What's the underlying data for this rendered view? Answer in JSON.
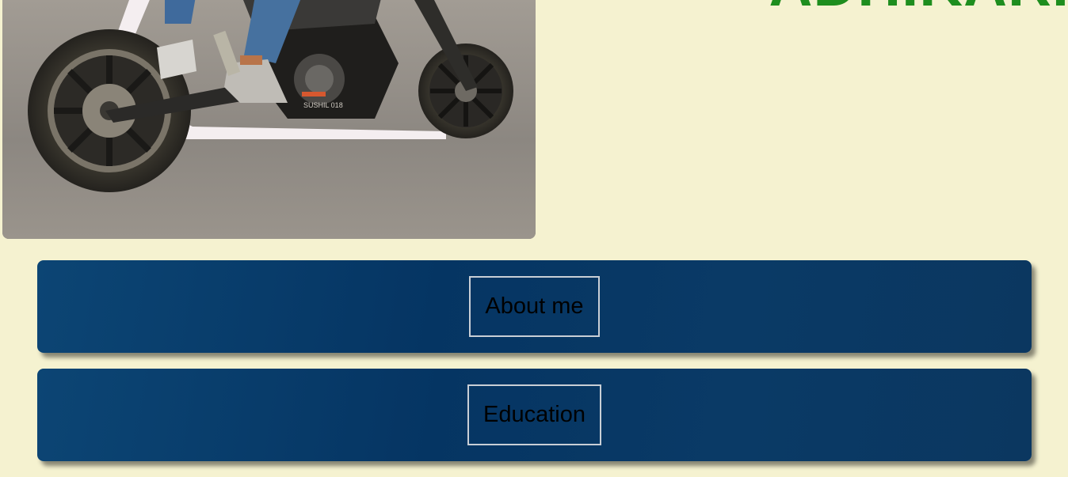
{
  "header": {
    "site_name": "ADHIKARI"
  },
  "hero": {
    "photo_caption_watermark": "SUSHIL 018"
  },
  "sections": [
    {
      "label": "About me"
    },
    {
      "label": "Education"
    }
  ],
  "colors": {
    "page_background": "#f5f2d0",
    "name_green": "#1e8e1e",
    "bar_navy": "#053563",
    "button_border": "#c9cfd6"
  }
}
